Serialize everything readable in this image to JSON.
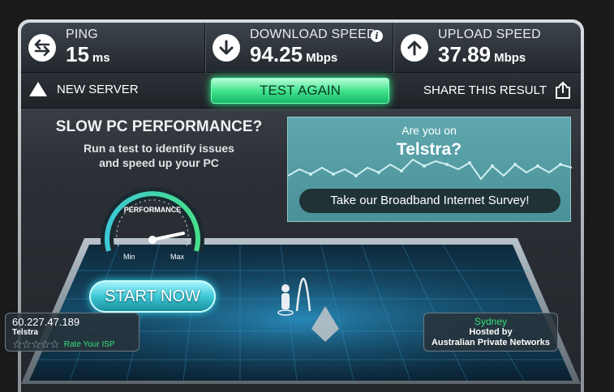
{
  "stats": {
    "ping": {
      "label": "PING",
      "value": "15",
      "unit": "ms",
      "icon": "swap-arrows-icon"
    },
    "download": {
      "label": "DOWNLOAD SPEED",
      "value": "94.25",
      "unit": "Mbps",
      "icon": "arrow-down-icon",
      "info": "i"
    },
    "upload": {
      "label": "UPLOAD SPEED",
      "value": "37.89",
      "unit": "Mbps",
      "icon": "arrow-up-icon"
    }
  },
  "actions": {
    "new_server": "NEW SERVER",
    "test_again": "TEST AGAIN",
    "share": "SHARE THIS RESULT"
  },
  "ad_left": {
    "title": "SLOW PC PERFORMANCE?",
    "line1": "Run a test to identify issues",
    "line2": "and speed up your PC",
    "gauge_label": "PERFORMANCE",
    "gauge_min": "Min",
    "gauge_max": "Max",
    "cta": "START NOW"
  },
  "ad_right": {
    "question": "Are you on",
    "isp": "Telstra?",
    "cta": "Take our Broadband Internet Survey!"
  },
  "client": {
    "ip": "60.227.47.189",
    "isp": "Telstra",
    "rating_stars": 5,
    "rate_label": "Rate Your ISP"
  },
  "server": {
    "city": "Sydney",
    "hosted_by": "Hosted by",
    "host": "Australian Private Networks"
  },
  "colors": {
    "accent_green": "#34e07a",
    "accent_cyan": "#3cc8d6",
    "panel": "#2c3036"
  }
}
